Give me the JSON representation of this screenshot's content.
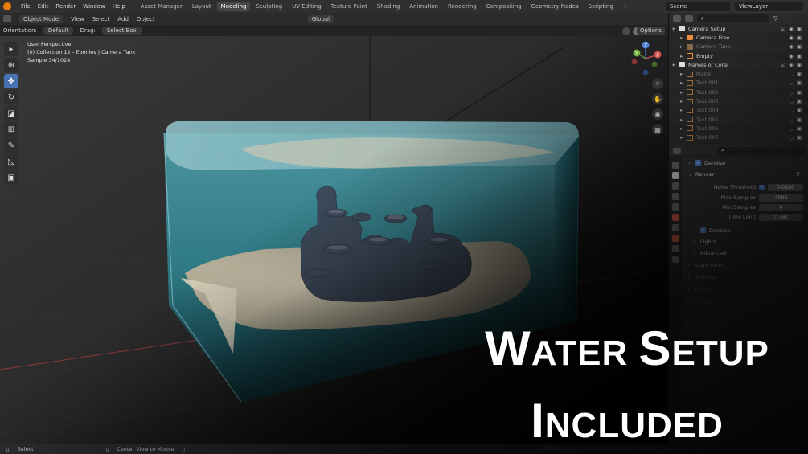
{
  "menu": [
    "File",
    "Edit",
    "Render",
    "Window",
    "Help"
  ],
  "workspaces": [
    "Asset Manager",
    "Layout",
    "Modeling",
    "Sculpting",
    "UV Editing",
    "Texture Paint",
    "Shading",
    "Animation",
    "Rendering",
    "Compositing",
    "Geometry Nodes",
    "Scripting",
    "+"
  ],
  "active_workspace": "Modeling",
  "scene_field": "Scene",
  "viewlayer_field": "ViewLayer",
  "viewport_header": {
    "mode": "Object Mode",
    "view": "View",
    "select": "Select",
    "add": "Add",
    "object": "Object",
    "transform": "Global"
  },
  "tool_settings": {
    "orientation_label": "Orientation:",
    "orientation_value": "Default",
    "drag_label": "Drag:",
    "drag_value": "Select Box",
    "options": "Options"
  },
  "viewport_info": {
    "line1": "User Perspective",
    "line2": "(0) Collection 12 - Ebonies | Camera Tank",
    "line3": "Sample 34/1024"
  },
  "gizmo": {
    "x": "X",
    "y": "Y",
    "z": "Z"
  },
  "outliner": {
    "rows": [
      {
        "label": "Camera Setup",
        "type": "collection",
        "indent": 0
      },
      {
        "label": "Camera Free",
        "type": "camera",
        "indent": 1
      },
      {
        "label": "Camera Tank",
        "type": "camera",
        "indent": 1,
        "dim": true
      },
      {
        "label": "Empty",
        "type": "empty",
        "indent": 1
      },
      {
        "label": "Names of Coral",
        "type": "collection",
        "indent": 0
      },
      {
        "label": "Plane",
        "type": "mesh",
        "indent": 1,
        "dim": true
      },
      {
        "label": "Text.001",
        "type": "text",
        "indent": 1,
        "dim": true
      },
      {
        "label": "Text.002",
        "type": "text",
        "indent": 1,
        "dim": true
      },
      {
        "label": "Text.003",
        "type": "text",
        "indent": 1,
        "dim": true
      },
      {
        "label": "Text.004",
        "type": "text",
        "indent": 1,
        "dim": true
      },
      {
        "label": "Text.005",
        "type": "text",
        "indent": 1,
        "dim": true
      },
      {
        "label": "Text.006",
        "type": "text",
        "indent": 1,
        "dim": true
      },
      {
        "label": "Text.007",
        "type": "text",
        "indent": 1,
        "dim": true
      }
    ]
  },
  "properties": {
    "denoise_top": "Denoise",
    "render": "Render",
    "noise_threshold_label": "Noise Threshold",
    "noise_threshold_value": "0.0100",
    "max_samples_label": "Max Samples",
    "max_samples_value": "4096",
    "min_samples_label": "Min Samples",
    "min_samples_value": "0",
    "time_limit_label": "Time Limit",
    "time_limit_value": "0 sec",
    "denoise_sub": "Denoise",
    "lights": "Lights",
    "advanced": "Advanced",
    "light_paths": "Light Paths",
    "volumes": "Volumes",
    "curves": "Curves",
    "simplify": "Simplify",
    "motion_blur": "Motion Blur",
    "transparent_glass": "Transparent Glass"
  },
  "statusbar": {
    "select": "Select",
    "center_view": "Center View to Mouse",
    "right": "Collection 12 - Ebonies | Camera Tank | Verts:0/0 | Faces:0/0 | Tris:0 | Objects:0/13 | Memory: 4.48 GiB | 4.2.0"
  },
  "banner": {
    "line1_cap": "W",
    "line1_rest": "ATER ",
    "line1_cap2": "S",
    "line1_rest2": "ETUP",
    "line2_cap": "I",
    "line2_rest": "NCLUDED"
  },
  "colors": {
    "accent": "#4772b3",
    "water": "#3a8e9a",
    "sand": "#d8cdb3",
    "coral": "#3d4656"
  }
}
